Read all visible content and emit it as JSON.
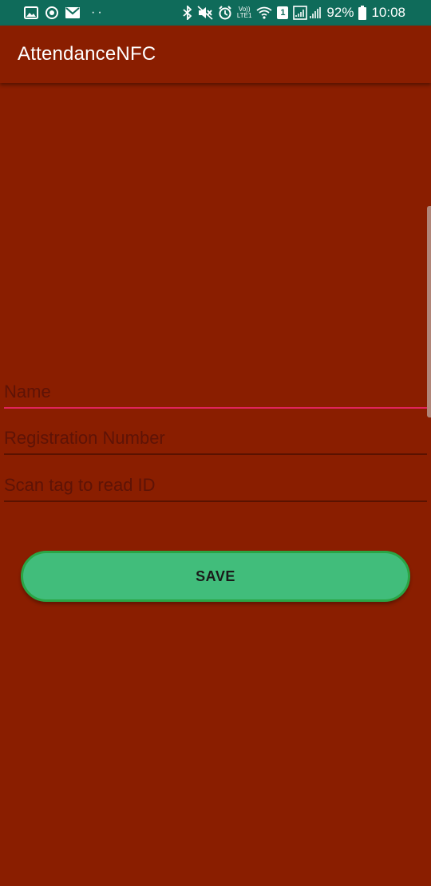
{
  "status_bar": {
    "left_icons": [
      "image-icon",
      "sync-icon",
      "mail-icon"
    ],
    "dots": "··",
    "right_icons": [
      "bluetooth-icon",
      "mute-icon",
      "alarm-icon",
      "volte-icon",
      "wifi-icon",
      "sim-icon",
      "signal-icon"
    ],
    "volte_label_top": "Vo))",
    "volte_label_bottom": "LTE1",
    "sim_label": "1",
    "battery": "92%",
    "time": "10:08"
  },
  "app_bar": {
    "title": "AttendanceNFC"
  },
  "form": {
    "name_placeholder": "Name",
    "registration_placeholder": "Registration Number",
    "scan_placeholder": "Scan tag to read ID",
    "save_label": "SAVE"
  },
  "colors": {
    "status_bar": "#0f6b5a",
    "background": "#8a1e00",
    "active_underline": "#e0245b",
    "button": "#41bd7b"
  }
}
